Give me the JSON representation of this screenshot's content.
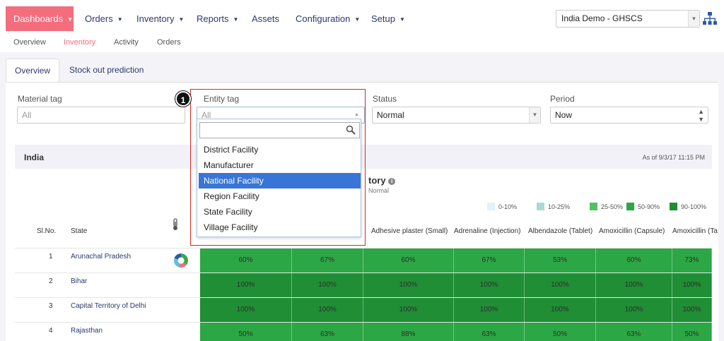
{
  "nav": {
    "items": [
      {
        "label": "Dashboards",
        "has_caret": true,
        "active": true
      },
      {
        "label": "Orders",
        "has_caret": true
      },
      {
        "label": "Inventory",
        "has_caret": true
      },
      {
        "label": "Reports",
        "has_caret": true
      },
      {
        "label": "Assets",
        "has_caret": false
      },
      {
        "label": "Configuration",
        "has_caret": true
      },
      {
        "label": "Setup",
        "has_caret": true
      }
    ],
    "domain_select": "India Demo - GHSCS",
    "accent_color": "#f36d7d"
  },
  "subnav": {
    "items": [
      "Overview",
      "Inventory",
      "Activity",
      "Orders"
    ],
    "active": "Inventory"
  },
  "tabs": [
    {
      "label": "Overview",
      "active": true
    },
    {
      "label": "Stock out prediction",
      "active": false
    }
  ],
  "filters": {
    "material": {
      "label": "Material tag",
      "value": "All"
    },
    "entity": {
      "label": "Entity tag",
      "value": "All"
    },
    "status": {
      "label": "Status",
      "value": "Normal"
    },
    "period": {
      "label": "Period",
      "value": "Now"
    }
  },
  "dropdown": {
    "search_value": "",
    "options": [
      "District Facility",
      "Manufacturer",
      "National Facility",
      "Region Facility",
      "State Facility",
      "Village Facility"
    ],
    "highlighted": "National Facility"
  },
  "annotation": {
    "step": "1"
  },
  "results": {
    "title": "India",
    "as_of": "As of 9/3/17 11:15 PM",
    "chart_title_visible": "tory",
    "chart_subtitle_visible": "Normal",
    "legend": [
      {
        "label": "0-10%",
        "color": "#e3f1f8"
      },
      {
        "label": "10-25%",
        "color": "#a9dcd1"
      },
      {
        "label": "25-50%",
        "color": "#4ec35f"
      },
      {
        "label": "50-90%",
        "color": "#2ca745"
      },
      {
        "label": "90-100%",
        "color": "#1f8e35"
      }
    ],
    "columns": {
      "slno": "Sl.No.",
      "state": "State",
      "materials": [
        "Adhesive plaster (Small)",
        "Adrenaline (Injection)",
        "Albendazole (Tablet)",
        "Amoxicillin (Capsule)",
        "Amoxicillin (Ta"
      ]
    },
    "rows": [
      {
        "sl": "1",
        "state": "Arunachal Pradesh",
        "cells": [
          "60%",
          "67%",
          "60%",
          "67%",
          "53%",
          "60%",
          "73%"
        ]
      },
      {
        "sl": "2",
        "state": "Bihar",
        "cells": [
          "100%",
          "100%",
          "100%",
          "100%",
          "100%",
          "100%",
          "100%"
        ]
      },
      {
        "sl": "3",
        "state": "Capital Territory of Delhi",
        "cells": [
          "100%",
          "100%",
          "100%",
          "100%",
          "100%",
          "100%",
          "100%"
        ]
      },
      {
        "sl": "4",
        "state": "Rajasthan",
        "cells": [
          "50%",
          "63%",
          "88%",
          "63%",
          "50%",
          "63%",
          "50%"
        ]
      }
    ]
  }
}
